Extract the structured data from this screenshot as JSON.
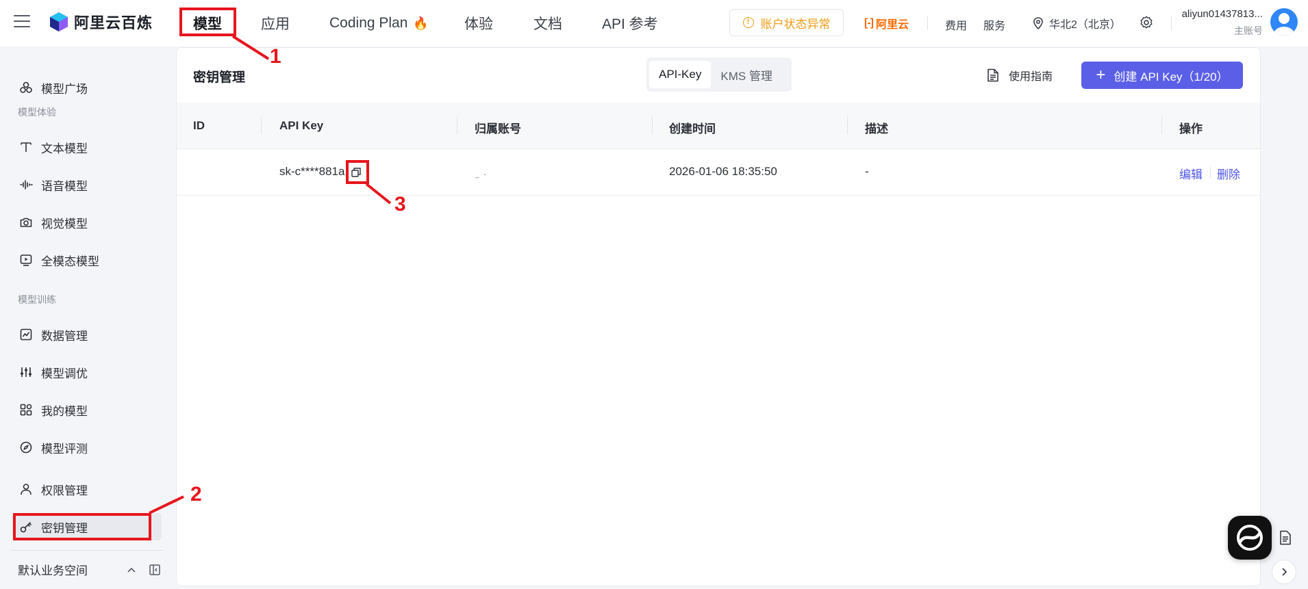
{
  "brand": {
    "name": "阿里云百炼"
  },
  "nav": {
    "items": [
      {
        "label": "模型"
      },
      {
        "label": "应用"
      },
      {
        "label": "Coding Plan"
      },
      {
        "label": "体验"
      },
      {
        "label": "文档"
      },
      {
        "label": "API 参考"
      }
    ]
  },
  "topbar": {
    "warning": "账户状态异常",
    "aliyun": "阿里云",
    "aliyun_bracket": "[-]",
    "fees": "费用",
    "service": "服务",
    "region": "华北2（北京）",
    "user_name": "aliyun01437813...",
    "user_role": "主账号"
  },
  "sidebar": {
    "items": [
      {
        "label": "模型广场"
      },
      {
        "label": "文本模型"
      },
      {
        "label": "语音模型"
      },
      {
        "label": "视觉模型"
      },
      {
        "label": "全模态模型"
      },
      {
        "label": "数据管理"
      },
      {
        "label": "模型调优"
      },
      {
        "label": "我的模型"
      },
      {
        "label": "模型评测"
      },
      {
        "label": "权限管理"
      },
      {
        "label": "密钥管理"
      }
    ],
    "groups": {
      "experience": "模型体验",
      "training": "模型训练"
    },
    "workspace": "默认业务空间"
  },
  "main": {
    "title": "密钥管理",
    "tabs": [
      {
        "label": "API-Key"
      },
      {
        "label": "KMS 管理"
      }
    ],
    "guide": "使用指南",
    "create_button": "创建 API Key（1/20）",
    "columns": {
      "id": "ID",
      "api_key": "API Key",
      "account": "归属账号",
      "created": "创建时间",
      "desc": "描述",
      "ops": "操作"
    },
    "rows": [
      {
        "id": "",
        "api_key": "sk-c****881a",
        "account": "_                    -",
        "created": "2026-01-06 18:35:50",
        "desc": "-",
        "edit": "编辑",
        "delete": "删除"
      }
    ]
  },
  "annotations": {
    "n1": "1",
    "n2": "2",
    "n3": "3"
  },
  "colors": {
    "accent": "#5b5fe7",
    "link": "#4d55e8",
    "warning": "#f09a14",
    "annotation": "#e6161d",
    "aliyun": "#ff6a00"
  }
}
